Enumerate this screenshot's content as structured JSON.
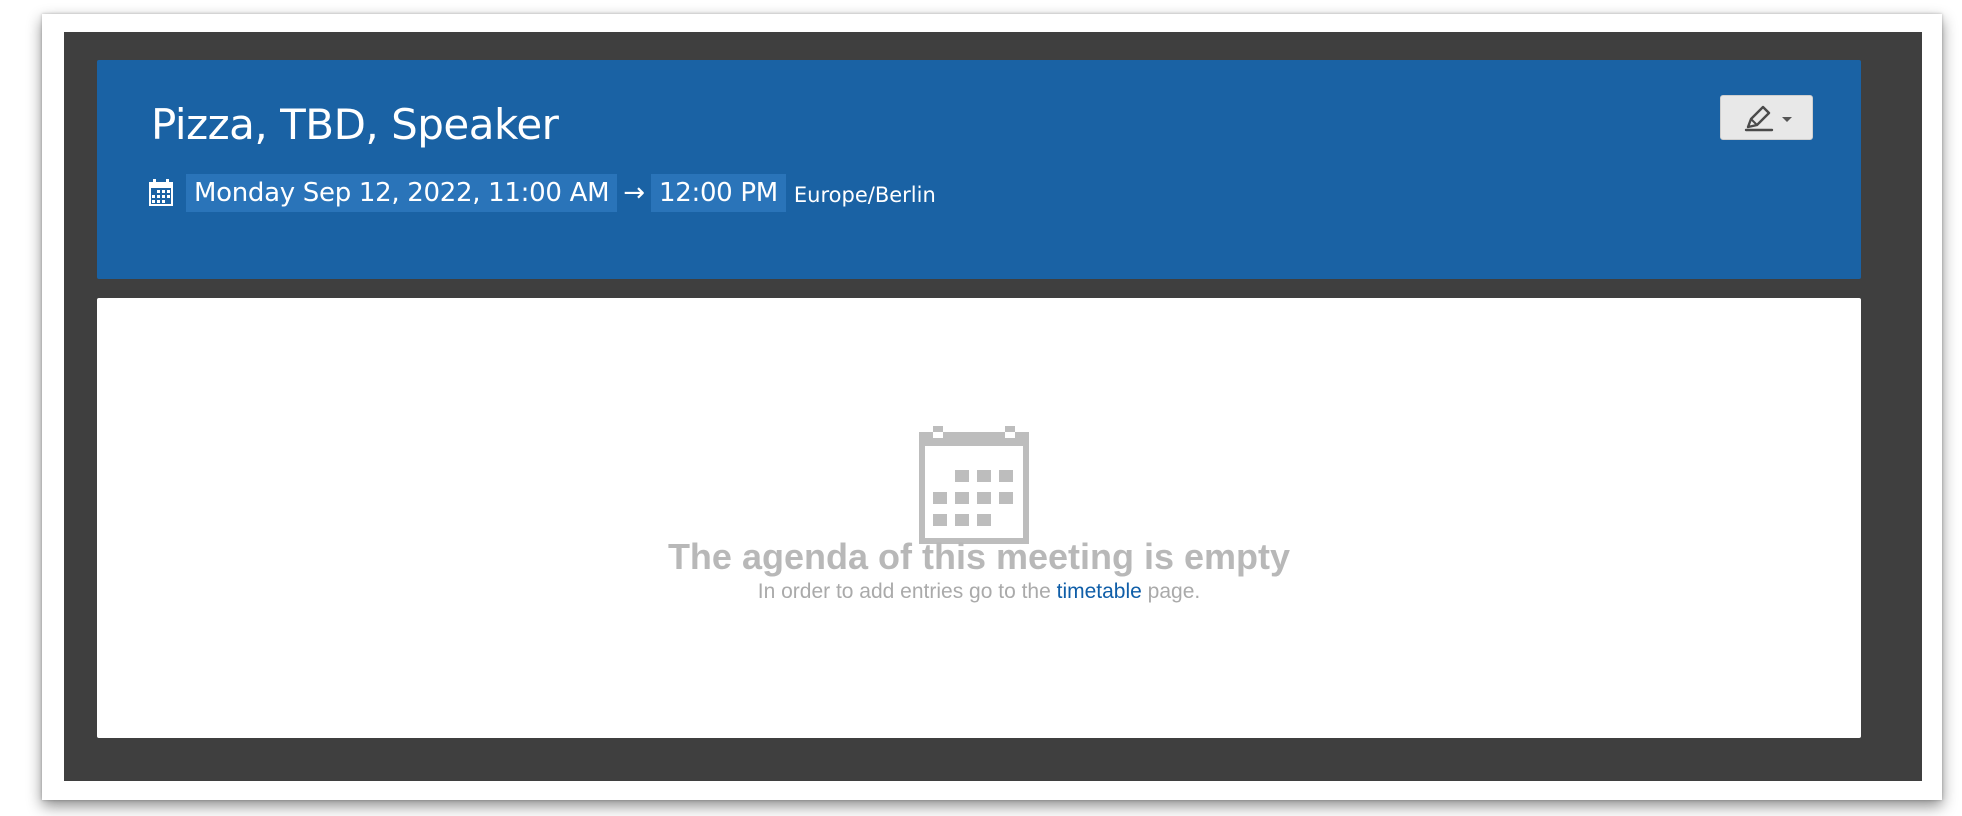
{
  "event": {
    "title": "Pizza, TBD, Speaker",
    "start": "Monday Sep 12, 2022, 11:00 AM",
    "arrow": "→",
    "end": "12:00 PM",
    "timezone": "Europe/Berlin"
  },
  "header": {
    "background_color": "#1a62a4",
    "chip_color": "#2a74b9",
    "edit_icon": "pen-icon",
    "calendar_icon": "calendar-icon"
  },
  "agenda": {
    "empty_title": "The agenda of this meeting is empty",
    "empty_prefix": "In order to add entries go to the ",
    "empty_link": "timetable",
    "empty_suffix": " page.",
    "link_color": "#0f5ea8",
    "empty_icon": "calendar-icon"
  }
}
